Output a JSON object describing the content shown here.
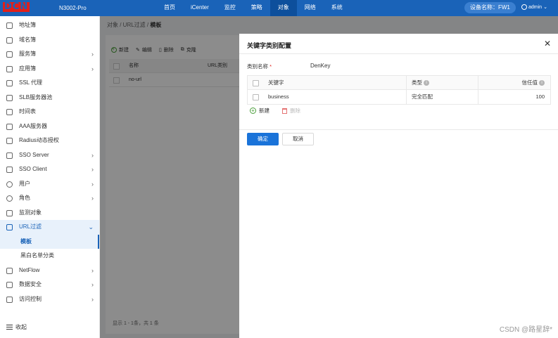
{
  "header": {
    "logo": "DCN",
    "model": "N3002-Pro",
    "nav": [
      "首页",
      "iCenter",
      "监控",
      "策略",
      "对象",
      "网络",
      "系统"
    ],
    "nav_active": "对象",
    "device_name": "设备名称：FW1",
    "user": "admin"
  },
  "sidebar": {
    "items": [
      {
        "label": "地址簿",
        "arrow": ""
      },
      {
        "label": "域名簿",
        "arrow": ""
      },
      {
        "label": "服务簿",
        "arrow": "›"
      },
      {
        "label": "应用簿",
        "arrow": "›"
      },
      {
        "label": "SSL 代理",
        "arrow": ""
      },
      {
        "label": "SLB服务器池",
        "arrow": ""
      },
      {
        "label": "时间表",
        "arrow": ""
      },
      {
        "label": "AAA服务器",
        "arrow": ""
      },
      {
        "label": "Radius动态授权",
        "arrow": ""
      },
      {
        "label": "SSO Server",
        "arrow": "›"
      },
      {
        "label": "SSO Client",
        "arrow": "›"
      },
      {
        "label": "用户",
        "arrow": "›"
      },
      {
        "label": "角色",
        "arrow": "›"
      },
      {
        "label": "监测对象",
        "arrow": ""
      },
      {
        "label": "URL过滤",
        "arrow": "⌄"
      },
      {
        "label": "NetFlow",
        "arrow": "›"
      },
      {
        "label": "数据安全",
        "arrow": "›"
      },
      {
        "label": "访问控制",
        "arrow": "›"
      }
    ],
    "sub_items": [
      "模板",
      "黑白名单分类"
    ],
    "collapse": "收起"
  },
  "breadcrumb": {
    "path": "对象 / URL过滤 / ",
    "current": "模板"
  },
  "background": {
    "toolbar": [
      "新建",
      "编辑",
      "删除",
      "克隆"
    ],
    "table_headers": [
      "名称",
      "URL类别"
    ],
    "rows": [
      "no-url"
    ],
    "pager": "显示 1 - 1条，共 1 条"
  },
  "drawer": {
    "title": "关键字类别配置",
    "category_label": "类别名称",
    "required_mark": "*",
    "category_value": "DenKey",
    "table_headers": {
      "keyword": "关键字",
      "type": "类型",
      "trust": "信任值"
    },
    "rows": [
      {
        "keyword": "business",
        "type": "完全匹配",
        "trust": "100"
      }
    ],
    "add": "新建",
    "delete": "删除",
    "ok": "确定",
    "cancel": "取消"
  },
  "watermark": "CSDN @路星辞*"
}
